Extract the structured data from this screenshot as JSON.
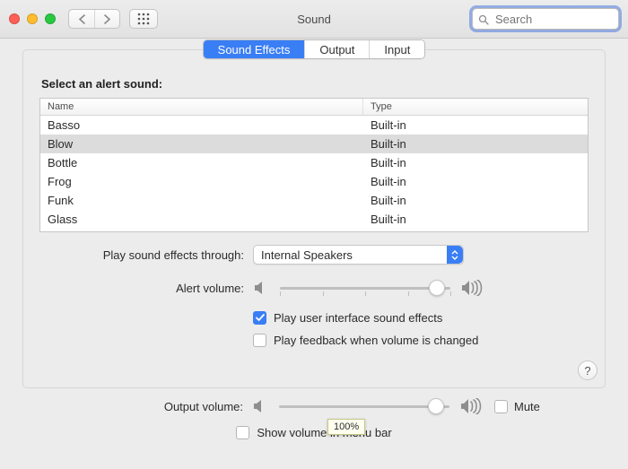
{
  "window": {
    "title": "Sound",
    "search_placeholder": "Search"
  },
  "tabs": [
    {
      "label": "Sound Effects",
      "active": true
    },
    {
      "label": "Output",
      "active": false
    },
    {
      "label": "Input",
      "active": false
    }
  ],
  "section": {
    "heading": "Select an alert sound:",
    "columns": {
      "name": "Name",
      "type": "Type"
    },
    "rows": [
      {
        "name": "Basso",
        "type": "Built-in",
        "selected": false
      },
      {
        "name": "Blow",
        "type": "Built-in",
        "selected": true
      },
      {
        "name": "Bottle",
        "type": "Built-in",
        "selected": false
      },
      {
        "name": "Frog",
        "type": "Built-in",
        "selected": false
      },
      {
        "name": "Funk",
        "type": "Built-in",
        "selected": false
      },
      {
        "name": "Glass",
        "type": "Built-in",
        "selected": false
      }
    ]
  },
  "play_through": {
    "label": "Play sound effects through:",
    "value": "Internal Speakers"
  },
  "alert_volume": {
    "label": "Alert volume:",
    "percent": 92
  },
  "checks": {
    "ui_sounds": {
      "label": "Play user interface sound effects",
      "checked": true
    },
    "feedback": {
      "label": "Play feedback when volume is changed",
      "checked": false
    }
  },
  "help": {
    "label": "?"
  },
  "output_volume": {
    "label": "Output volume:",
    "percent": 92,
    "tooltip": "100%"
  },
  "mute": {
    "label": "Mute",
    "checked": false
  },
  "menubar": {
    "label": "Show volume in menu bar",
    "checked": false
  }
}
